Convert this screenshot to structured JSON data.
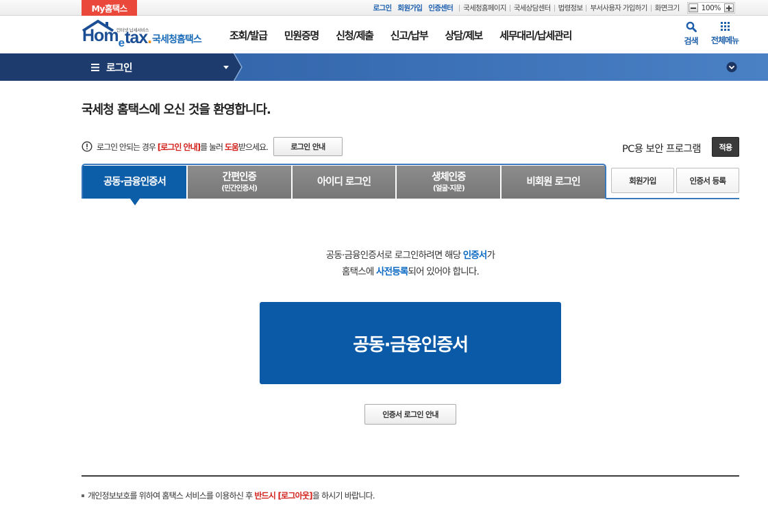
{
  "theme": {
    "primary": "#0b5aa8",
    "accent_red": "#d3221c",
    "navy": "#1d3c6d",
    "my_tab": "#e9483b"
  },
  "topbar": {
    "my_hometax": "My홈택스",
    "primary_links": [
      "로그인",
      "회원가입",
      "인증센터"
    ],
    "links": [
      "국세청홈페이지",
      "국세상담센터",
      "법령정보",
      "부서사용자 가입하기"
    ],
    "zoom": {
      "label": "화면크기",
      "value": "100%",
      "minus_icon": "minus-icon",
      "plus_icon": "plus-icon"
    }
  },
  "header": {
    "logo": {
      "tagline": "인터넷 납세서비스",
      "word_1": "Hom",
      "word_2": "e",
      "word_3": "tax",
      "dot": "."
    },
    "brand": "국세청홈택스",
    "nav": [
      "조회/발급",
      "민원증명",
      "신청/제출",
      "신고/납부",
      "상담/제보",
      "세무대리/납세관리"
    ],
    "search": {
      "label": "검색",
      "icon": "search-icon"
    },
    "all_menu": {
      "label": "전체메뉴",
      "icon": "grid-icon"
    }
  },
  "location_bar": {
    "menu_icon": "hamburger-icon",
    "current": "로그인",
    "expand_icon": "chevron-down-circle-icon"
  },
  "login": {
    "welcome": "국세청 홈택스에 오신 것을 환영합니다.",
    "help": {
      "icon": "alert-circle-icon",
      "text_1": "로그인 안되는 경우 ",
      "link": "[로그인 안내]",
      "text_2": "를 눌러 ",
      "emphasis": "도움",
      "text_3": "받으세요.",
      "button": "로그인 안내"
    },
    "security": {
      "label": "PC용 보안 프로그램",
      "button": "적용"
    },
    "tabs": [
      {
        "label": "공동·금융인증서",
        "active": true
      },
      {
        "label": "간편인증",
        "sub": "(민간인증서)",
        "active": false
      },
      {
        "label": "아이디 로그인",
        "active": false
      },
      {
        "label": "생체인증",
        "sub": "(얼굴·지문)",
        "active": false
      },
      {
        "label": "비회원 로그인",
        "active": false
      }
    ],
    "side_buttons": [
      "회원가입",
      "인증서 등록"
    ],
    "notice": {
      "line_1": {
        "text_1": "공동·금융인증서로 로그인하려면 해당 ",
        "emphasis": "인증서",
        "text_2": "가"
      },
      "line_2": {
        "text_1": "홈택스에 ",
        "emphasis": "사전등록",
        "text_2": "되어 있어야 합니다."
      }
    },
    "cert_login_button": "공동·금융인증서",
    "guide_button": "인증서 로그인 안내"
  },
  "footer_notice": {
    "text_1": "개인정보보호를 위하여 홈택스 서비스를 이용하신 후 ",
    "emphasis": "반드시 [로그아웃]",
    "text_2": "을 하시기 바랍니다."
  }
}
